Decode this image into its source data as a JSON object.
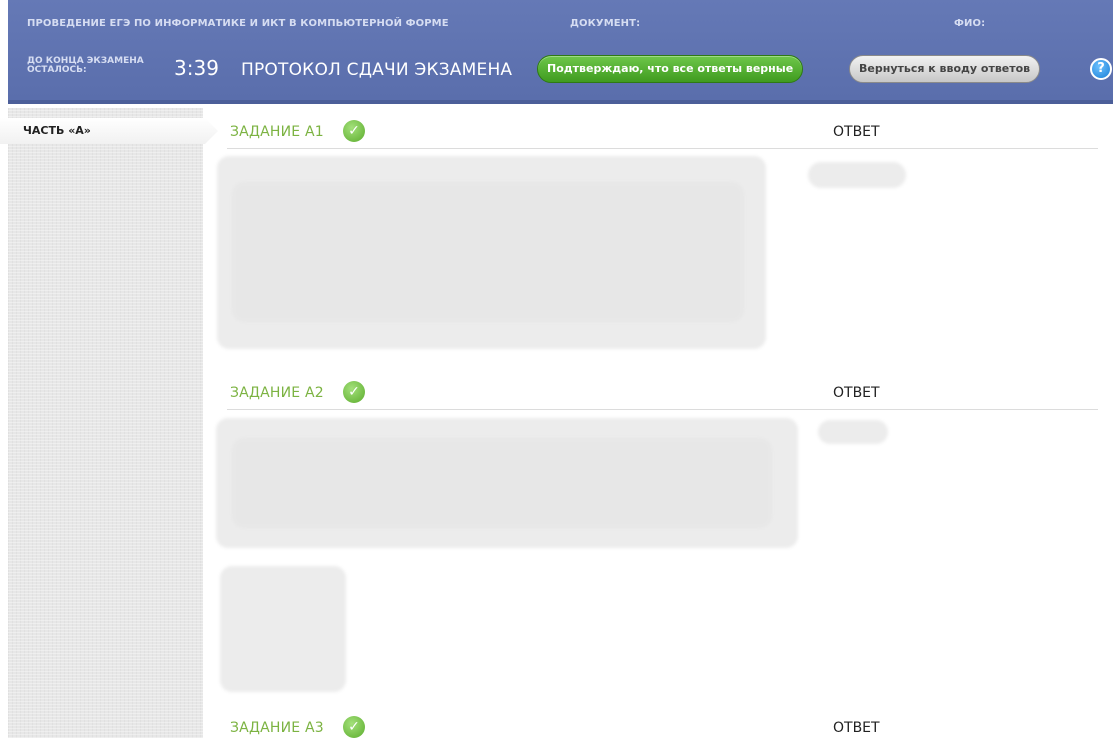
{
  "header": {
    "exam_title": "ПРОВЕДЕНИЕ ЕГЭ ПО ИНФОРМАТИКЕ И ИКТ В КОМПЬЮТЕРНОЙ ФОРМЕ",
    "document_label": "ДОКУМЕНТ:",
    "fio_label": "ФИО:",
    "time_left_label": "ДО КОНЦА ЭКЗАМЕНА ОСТАЛОСЬ:",
    "time_left_value": "3:39",
    "protocol_title": "ПРОТОКОЛ СДАЧИ ЭКЗАМЕНА",
    "confirm_button": "Подтверждаю, что все ответы верные",
    "back_button": "Вернуться к вводу ответов",
    "help_icon": "question-icon"
  },
  "sidebar": {
    "part_label": "ЧАСТЬ «А»"
  },
  "tasks": [
    {
      "title": "ЗАДАНИЕ А1",
      "answer_label": "ОТВЕТ",
      "status_icon": "check-icon"
    },
    {
      "title": "ЗАДАНИЕ А2",
      "answer_label": "ОТВЕТ",
      "status_icon": "check-icon"
    },
    {
      "title": "ЗАДАНИЕ А3",
      "answer_label": "ОТВЕТ",
      "status_icon": "check-icon"
    }
  ],
  "colors": {
    "header_bg": "#5f73b1",
    "confirm_green": "#4caf2a",
    "task_title_green": "#7cb342"
  }
}
